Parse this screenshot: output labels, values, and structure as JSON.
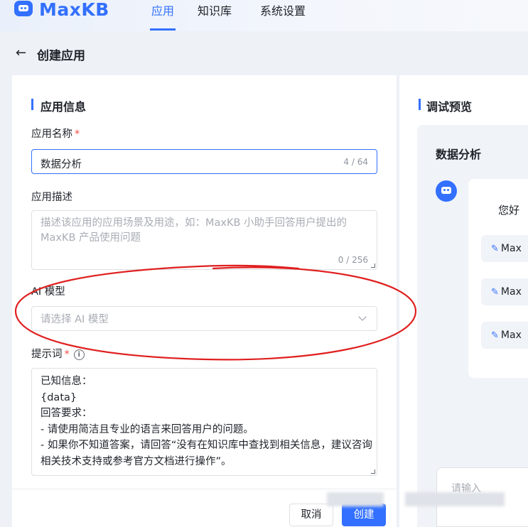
{
  "app": {
    "brand": "MaxKB",
    "brand_color": "#3370ff"
  },
  "nav": {
    "items": [
      {
        "label": "应用",
        "active": true
      },
      {
        "label": "知识库",
        "active": false
      },
      {
        "label": "系统设置",
        "active": false
      }
    ]
  },
  "page": {
    "back_icon": "←",
    "title": "创建应用"
  },
  "form": {
    "section_title": "应用信息",
    "name": {
      "label": "应用名称",
      "required_mark": "*",
      "value": "数据分析",
      "counter": "4 / 64"
    },
    "desc": {
      "label": "应用描述",
      "placeholder": "描述该应用的应用场景及用途，如：MaxKB 小助手回答用户提出的 MaxKB 产品使用问题",
      "counter": "0 / 256"
    },
    "model": {
      "label": "AI 模型",
      "placeholder": "请选择 AI 模型"
    },
    "prompt": {
      "label": "提示词",
      "required_mark": "*",
      "info_icon": "i",
      "value": "已知信息：\n{data}\n回答要求：\n- 请使用简洁且专业的语言来回答用户的问题。\n- 如果你不知道答案，请回答“没有在知识库中查找到相关信息，建议咨询相关技术支持或参考官方文档进行操作”。"
    }
  },
  "footer": {
    "cancel_label": "取消",
    "create_label": "创建"
  },
  "preview": {
    "section_title": "调试预览",
    "app_name": "数据分析",
    "greeting": "您好",
    "suggestions": [
      "Max",
      "Max",
      "Max"
    ],
    "input_placeholder": "请输入"
  },
  "annotation": {
    "color": "#e02020"
  }
}
